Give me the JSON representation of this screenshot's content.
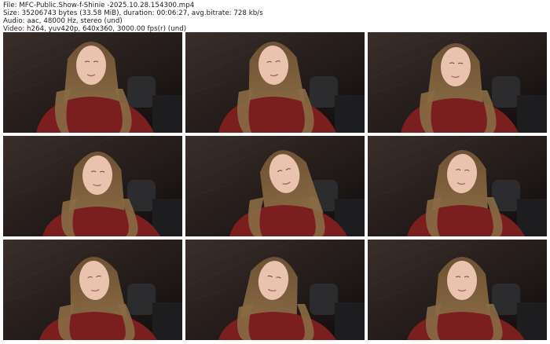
{
  "info": {
    "file_line": "File: MFC-Public.Show-f-Shinie -2025.10.28.154300.mp4",
    "size_line": "Size: 35206743 bytes (33.58 MiB), duration: 00:06:27, avg.bitrate: 728 kb/s",
    "audio_line": "Audio: aac, 48000 Hz, stereo (und)",
    "video_line": "Video: h264, yuv420p, 640x360, 3000.00 fps(r) (und)"
  },
  "thumbnails": [
    {
      "timestamp": ""
    },
    {
      "timestamp": ""
    },
    {
      "timestamp": ""
    },
    {
      "timestamp": ""
    },
    {
      "timestamp": ""
    },
    {
      "timestamp": ""
    },
    {
      "timestamp": ""
    },
    {
      "timestamp": ""
    },
    {
      "timestamp": ""
    }
  ],
  "colors": {
    "sweater": "#7a1e1e",
    "hair": "#8a6a45",
    "skin": "#e9c3ae",
    "wall": "#3a2e2a"
  }
}
